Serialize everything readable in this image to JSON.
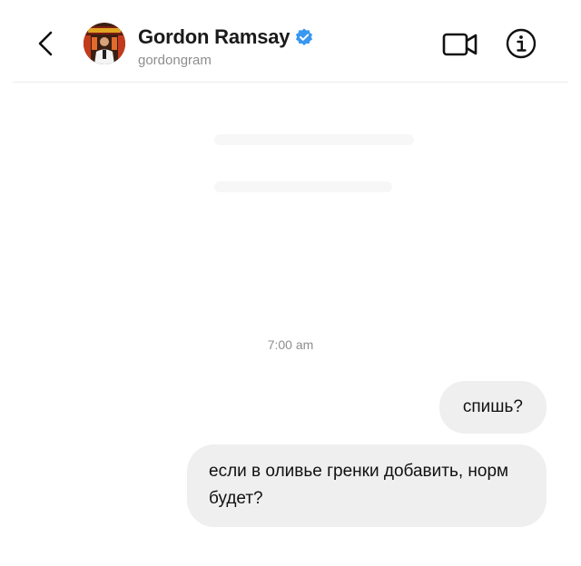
{
  "header": {
    "name": "Gordon Ramsay",
    "handle": "gordongram",
    "icons": {
      "back": "chevron-left-icon",
      "verified": "verified-badge-icon",
      "video": "video-call-icon",
      "info": "info-icon"
    },
    "colors": {
      "verified": "#3897f0",
      "handle": "#8e8e8e"
    }
  },
  "conversation": {
    "timestamp": "7:00 am",
    "messages": [
      {
        "sender": "me",
        "text": "спишь?"
      },
      {
        "sender": "me",
        "text": "если в оливье гренки добавить, норм будет?"
      }
    ],
    "colors": {
      "bubble": "#efefef",
      "timestamp": "#8e8e8e"
    }
  }
}
